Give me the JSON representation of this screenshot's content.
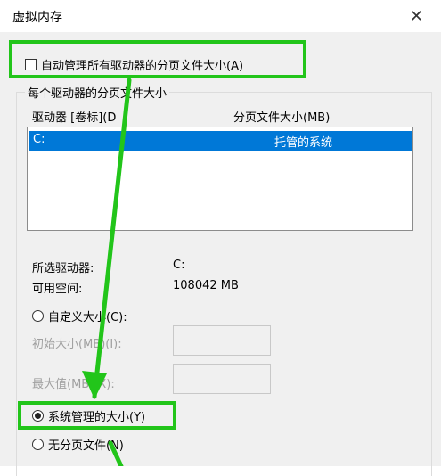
{
  "window": {
    "title": "虚拟内存"
  },
  "auto_manage": {
    "label": "自动管理所有驱动器的分页文件大小(A)",
    "checked": false
  },
  "group": {
    "title": "每个驱动器的分页文件大小"
  },
  "columns": {
    "drive": "驱动器 [卷标](D",
    "size": "分页文件大小(MB)"
  },
  "drives": [
    {
      "drive": "C:",
      "size": "托管的系统"
    }
  ],
  "selected": {
    "drive_label": "所选驱动器:",
    "drive_value": "C:",
    "space_label": "可用空间:",
    "space_value": "108042 MB"
  },
  "options": {
    "custom": "自定义大小(C):",
    "initial_label": "初始大小(MB)(I):",
    "max_label": "最大值(MB)(X):",
    "system": "系统管理的大小(Y)",
    "none": "无分页文件(N)"
  },
  "annotation_color": "#22c51a"
}
